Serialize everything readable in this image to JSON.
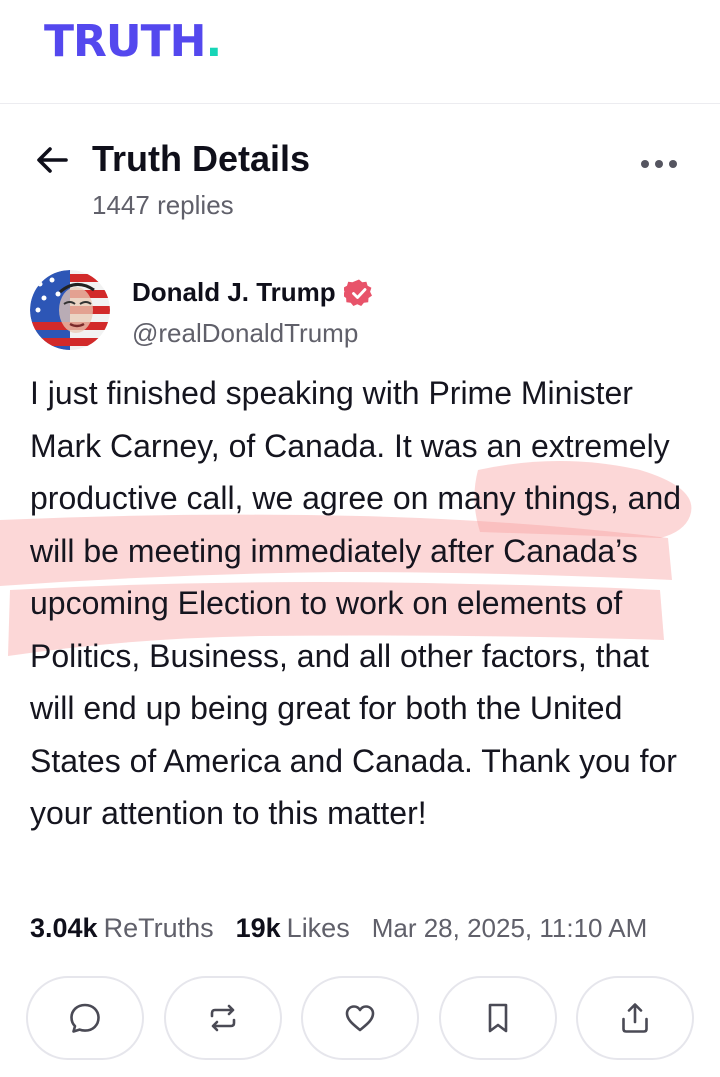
{
  "app": {
    "logo_text": "TRUTH",
    "logo_dot": ".",
    "brand_color": "#5448ee",
    "accent_color": "#17d5b7"
  },
  "header": {
    "title": "Truth Details",
    "replies": "1447 replies",
    "back_icon": "arrow-left-icon",
    "more_icon": "more-horizontal-icon"
  },
  "post": {
    "author_name": "Donald J. Trump",
    "author_handle": "@realDonaldTrump",
    "verified_icon": "verified-badge-icon",
    "verified_color": "#e8536a",
    "body": "I just finished speaking with Prime Minister Mark Carney, of Canada. It was an extremely productive call, we agree on many things, and will be meeting immediately after Canada’s upcoming Election to work on elements of Politics, Business, and all other factors, that will end up being great for both the United States of America and Canada. Thank you for your attention to this matter!",
    "highlight_color": "#f8a5a5",
    "stats": {
      "retruths_count": "3.04k",
      "retruths_label": "ReTruths",
      "likes_count": "19k",
      "likes_label": "Likes",
      "timestamp": "Mar 28, 2025, 11:10 AM"
    }
  },
  "actions": [
    {
      "name": "reply",
      "icon": "comment-icon"
    },
    {
      "name": "retruth",
      "icon": "repost-icon"
    },
    {
      "name": "like",
      "icon": "heart-icon"
    },
    {
      "name": "bookmark",
      "icon": "bookmark-icon"
    },
    {
      "name": "share",
      "icon": "share-icon"
    }
  ]
}
